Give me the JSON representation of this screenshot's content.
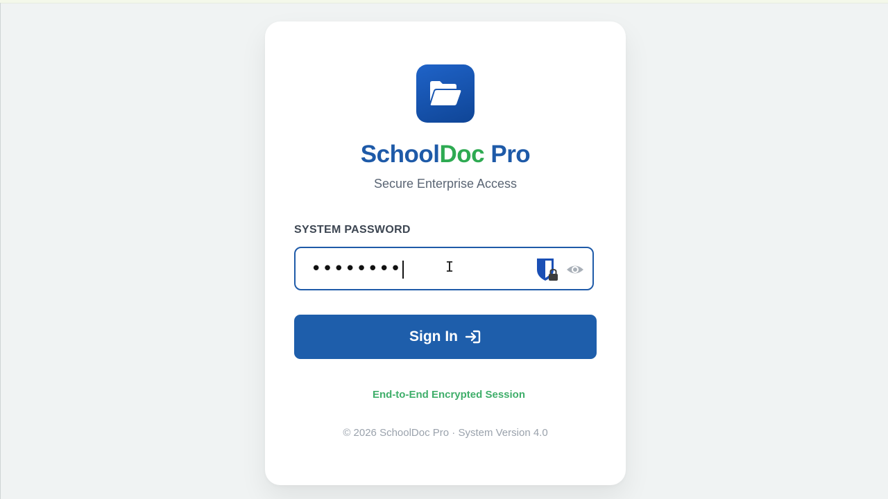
{
  "brand": {
    "name_part1": "School",
    "name_part2": "Doc",
    "name_part3": "Pro",
    "subtitle": "Secure Enterprise Access",
    "logo_icon": "folder-open-icon"
  },
  "form": {
    "password_label": "SYSTEM PASSWORD",
    "password_value": "••••••••",
    "password_manager_icon": "bitwarden-shield-icon",
    "visibility_icon": "eye-icon",
    "signin_label": "Sign In",
    "signin_icon": "sign-in-arrow-icon"
  },
  "security_note": "End-to-End Encrypted Session",
  "footer": "© 2026 SchoolDoc Pro · System Version 4.0",
  "colors": {
    "primary": "#1e5aa8",
    "accent_green": "#2eaa52",
    "note_green": "#3fae6a",
    "page_bg": "#f0f3f3"
  }
}
